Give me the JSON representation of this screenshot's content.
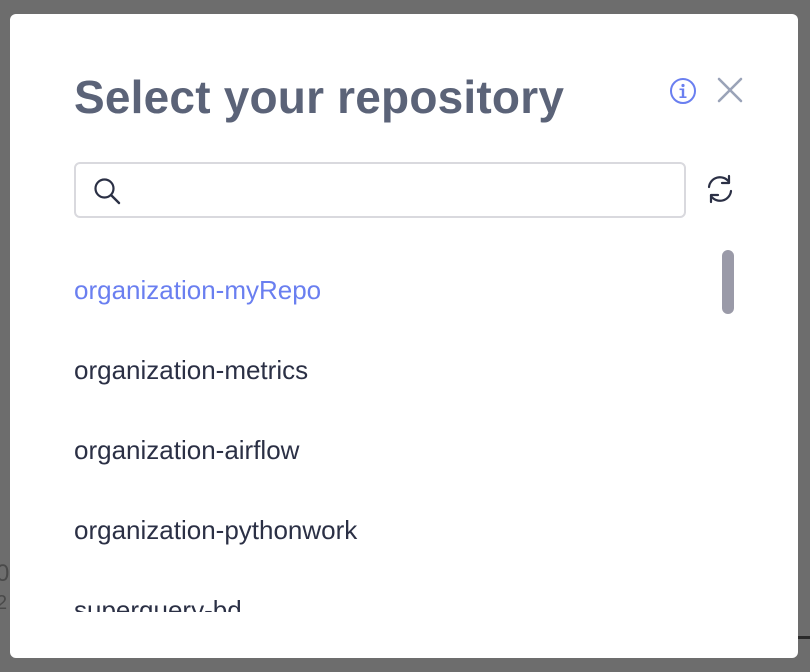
{
  "modal": {
    "title": "Select your repository"
  },
  "icons": {
    "info": "info-icon",
    "close": "close-icon",
    "search": "search-icon",
    "refresh": "refresh-icon"
  },
  "search": {
    "value": "",
    "placeholder": ""
  },
  "repositories": [
    {
      "name": "organization-myRepo",
      "selected": true
    },
    {
      "name": "organization-metrics",
      "selected": false
    },
    {
      "name": "organization-airflow",
      "selected": false
    },
    {
      "name": "organization-pythonwork",
      "selected": false
    },
    {
      "name": "superquery-bd",
      "selected": false
    }
  ],
  "colors": {
    "accent": "#6a7ff0",
    "title": "#5b6378",
    "text": "#2b3045",
    "close": "#9aa3b8",
    "scrollbar": "#9a9aa8"
  }
}
